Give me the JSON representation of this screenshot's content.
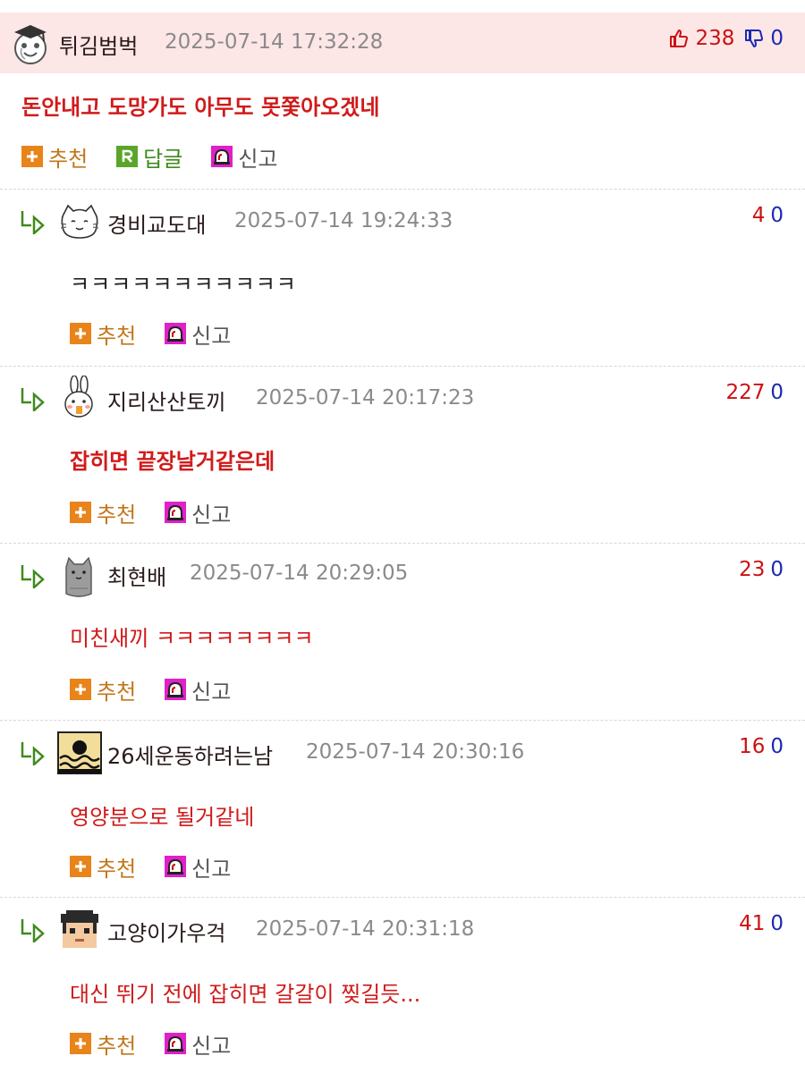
{
  "colors": {
    "header_bg": "#fde6e6",
    "accent_red": "#d11a1a",
    "vote_up": "#cc1111",
    "vote_down": "#1a2ab0",
    "recommend_orange": "#e8841a",
    "reply_green": "#5aa52a",
    "report_magenta": "#e020c8"
  },
  "main": {
    "avatar_icon": "graduation-penguin-avatar-icon",
    "nickname": "튀김범벅",
    "datetime": "2025-07-14 17:32:28",
    "upvotes": "238",
    "downvotes": "0",
    "content": "돈안내고 도망가도 아무도 못쫓아오겠네",
    "actions": {
      "recommend": "추천",
      "reply": "답글",
      "report": "신고"
    }
  },
  "replies": [
    {
      "avatar_icon": "fluffy-cat-avatar-icon",
      "nickname": "경비교도대",
      "datetime": "2025-07-14 19:24:33",
      "upvotes": "4",
      "downvotes": "0",
      "content": "ㅋㅋㅋㅋㅋㅋㅋㅋㅋㅋㅋ",
      "actions": {
        "recommend": "추천",
        "report": "신고"
      }
    },
    {
      "avatar_icon": "bunny-avatar-icon",
      "nickname": "지리산산토끼",
      "datetime": "2025-07-14 20:17:23",
      "upvotes": "227",
      "downvotes": "0",
      "content": "잡히면 끝장날거같은데",
      "actions": {
        "recommend": "추천",
        "report": "신고"
      }
    },
    {
      "avatar_icon": "gray-cat-avatar-icon",
      "nickname": "최현배",
      "datetime": "2025-07-14 20:29:05",
      "upvotes": "23",
      "downvotes": "0",
      "content": "미친새끼 ㅋㅋㅋㅋㅋㅋㅋㅋ",
      "actions": {
        "recommend": "추천",
        "report": "신고"
      }
    },
    {
      "avatar_icon": "sunset-wave-avatar-icon",
      "nickname": "26세운동하려는남",
      "datetime": "2025-07-14 20:30:16",
      "upvotes": "16",
      "downvotes": "0",
      "content": "영양분으로 될거같네",
      "actions": {
        "recommend": "추천",
        "report": "신고"
      }
    },
    {
      "avatar_icon": "pixel-graduate-avatar-icon",
      "nickname": "고양이가우걱",
      "datetime": "2025-07-14 20:31:18",
      "upvotes": "41",
      "downvotes": "0",
      "content": "대신 뛰기 전에 잡히면 갈갈이 찢길듯...",
      "actions": {
        "recommend": "추천",
        "report": "신고"
      }
    }
  ]
}
